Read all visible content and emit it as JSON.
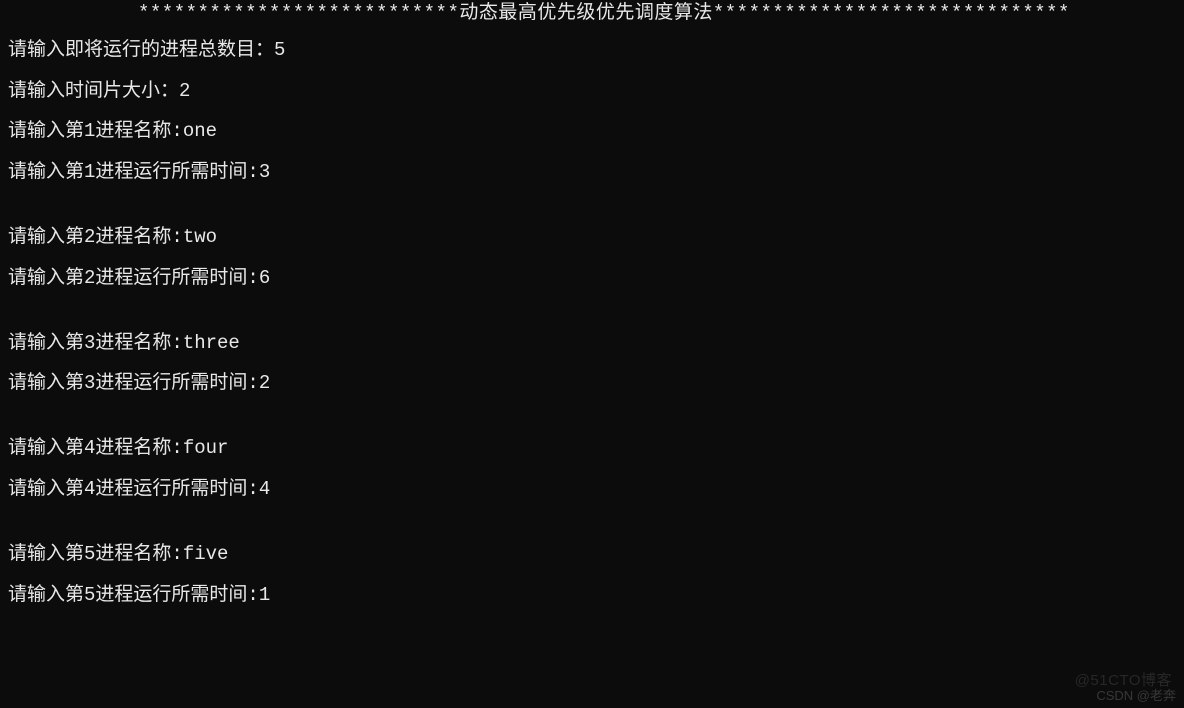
{
  "header": {
    "stars_left": "***************************",
    "title": "动态最高优先级优先调度算法",
    "stars_right": "******************************"
  },
  "prompts": {
    "total_processes": {
      "label": "请输入即将运行的进程总数目：",
      "value": "5"
    },
    "time_slice": {
      "label": "请输入时间片大小：",
      "value": "2"
    },
    "processes": [
      {
        "name_label": "请输入第1进程名称:",
        "name_value": "one",
        "time_label": "请输入第1进程运行所需时间:",
        "time_value": "3"
      },
      {
        "name_label": "请输入第2进程名称:",
        "name_value": "two",
        "time_label": "请输入第2进程运行所需时间:",
        "time_value": "6"
      },
      {
        "name_label": "请输入第3进程名称:",
        "name_value": "three",
        "time_label": "请输入第3进程运行所需时间:",
        "time_value": "2"
      },
      {
        "name_label": "请输入第4进程名称:",
        "name_value": "four",
        "time_label": "请输入第4进程运行所需时间:",
        "time_value": "4"
      },
      {
        "name_label": "请输入第5进程名称:",
        "name_value": "five",
        "time_label": "请输入第5进程运行所需时间:",
        "time_value": "1"
      }
    ]
  },
  "watermarks": {
    "top": "@51CTO博客",
    "bottom": "CSDN @老奔"
  }
}
